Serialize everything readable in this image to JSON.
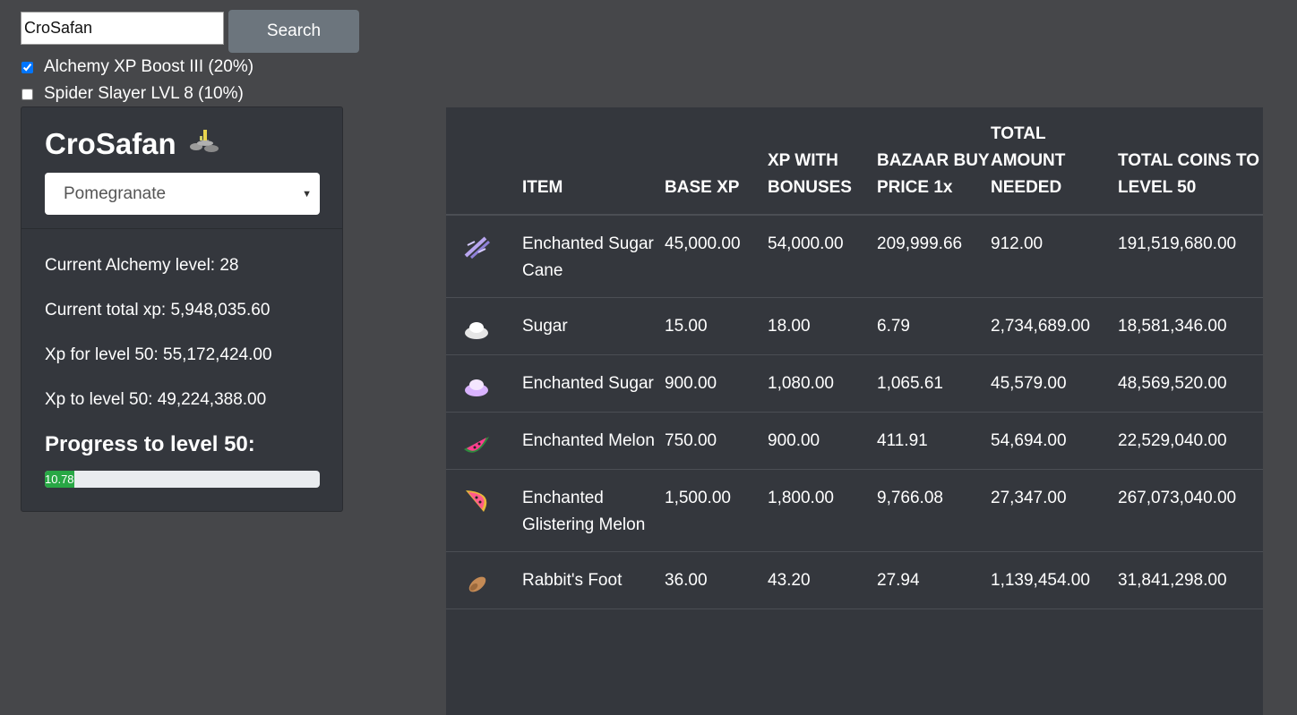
{
  "search": {
    "value": "CroSafan",
    "button_label": "Search"
  },
  "boosts": [
    {
      "label": "Alchemy XP Boost III (20%)",
      "checked": true
    },
    {
      "label": "Spider Slayer LVL 8 (10%)",
      "checked": false
    }
  ],
  "profile": {
    "name": "CroSafan",
    "icon": "brewing-stand-icon",
    "selected_profile": "Pomegranate",
    "stats": [
      "Current Alchemy level: 28",
      "Current total xp: 5,948,035.60",
      "Xp for level 50: 55,172,424.00",
      "Xp to level 50: 49,224,388.00"
    ],
    "progress_title": "Progress to level 50:",
    "progress_percent": 10.78,
    "progress_label": "10.78"
  },
  "table": {
    "headers": [
      "",
      "ITEM",
      "BASE XP",
      "XP WITH BONUSES",
      "BAZAAR BUY PRICE 1x",
      "TOTAL AMOUNT NEEDED",
      "TOTAL COINS TO LEVEL 50"
    ],
    "rows": [
      {
        "icon": "enchanted-sugar-cane-icon",
        "item": "Enchanted Sugar Cane",
        "base_xp": "45,000.00",
        "xp_bonus": "54,000.00",
        "price": "209,999.66",
        "amount": "912.00",
        "coins": "191,519,680.00"
      },
      {
        "icon": "sugar-icon",
        "item": "Sugar",
        "base_xp": "15.00",
        "xp_bonus": "18.00",
        "price": "6.79",
        "amount": "2,734,689.00",
        "coins": "18,581,346.00"
      },
      {
        "icon": "enchanted-sugar-icon",
        "item": "Enchanted Sugar",
        "base_xp": "900.00",
        "xp_bonus": "1,080.00",
        "price": "1,065.61",
        "amount": "45,579.00",
        "coins": "48,569,520.00"
      },
      {
        "icon": "enchanted-melon-icon",
        "item": "Enchanted Melon",
        "base_xp": "750.00",
        "xp_bonus": "900.00",
        "price": "411.91",
        "amount": "54,694.00",
        "coins": "22,529,040.00"
      },
      {
        "icon": "enchanted-glistering-melon-icon",
        "item": "Enchanted Glistering Melon",
        "base_xp": "1,500.00",
        "xp_bonus": "1,800.00",
        "price": "9,766.08",
        "amount": "27,347.00",
        "coins": "267,073,040.00"
      },
      {
        "icon": "rabbits-foot-icon",
        "item": "Rabbit's Foot",
        "base_xp": "36.00",
        "xp_bonus": "43.20",
        "price": "27.94",
        "amount": "1,139,454.00",
        "coins": "31,841,298.00"
      }
    ]
  },
  "colors": {
    "background": "#46474a",
    "panel": "#34373d",
    "button": "#6c757d",
    "progress": "#28a745"
  }
}
